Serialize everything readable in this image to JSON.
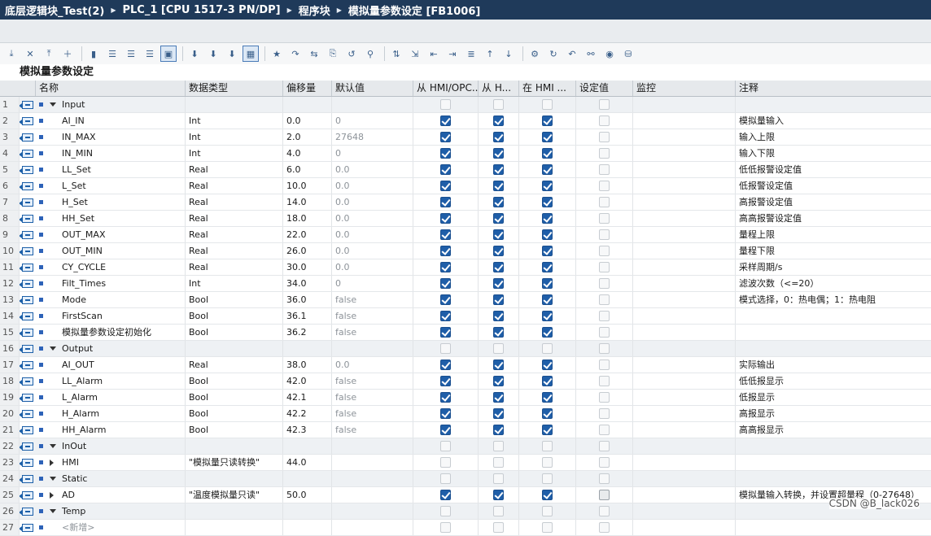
{
  "titlebar": {
    "crumbs": [
      "底层逻辑块_Test(2)",
      "PLC_1 [CPU 1517-3 PN/DP]",
      "程序块",
      "模拟量参数设定 [FB1006]"
    ]
  },
  "block_title": "模拟量参数设定",
  "columns": [
    "名称",
    "数据类型",
    "偏移量",
    "默认值",
    "从 HMI/OPC...",
    "从 H...",
    "在 HMI ...",
    "设定值",
    "监控",
    "注释"
  ],
  "rows": [
    {
      "num": "1",
      "kind": "section",
      "name": "Input",
      "type": "",
      "offset": "",
      "default": "",
      "c1": false,
      "c2": false,
      "c3": false,
      "set": false,
      "comment": ""
    },
    {
      "num": "2",
      "kind": "item",
      "name": "AI_IN",
      "type": "Int",
      "offset": "0.0",
      "default": "0",
      "c1": true,
      "c2": true,
      "c3": true,
      "set": false,
      "comment": "模拟量输入"
    },
    {
      "num": "3",
      "kind": "item",
      "name": "IN_MAX",
      "type": "Int",
      "offset": "2.0",
      "default": "27648",
      "c1": true,
      "c2": true,
      "c3": true,
      "set": false,
      "comment": "输入上限"
    },
    {
      "num": "4",
      "kind": "item",
      "name": "IN_MIN",
      "type": "Int",
      "offset": "4.0",
      "default": "0",
      "c1": true,
      "c2": true,
      "c3": true,
      "set": false,
      "comment": "输入下限"
    },
    {
      "num": "5",
      "kind": "item",
      "name": "LL_Set",
      "type": "Real",
      "offset": "6.0",
      "default": "0.0",
      "c1": true,
      "c2": true,
      "c3": true,
      "set": false,
      "comment": "低低报警设定值"
    },
    {
      "num": "6",
      "kind": "item",
      "name": "L_Set",
      "type": "Real",
      "offset": "10.0",
      "default": "0.0",
      "c1": true,
      "c2": true,
      "c3": true,
      "set": false,
      "comment": "低报警设定值"
    },
    {
      "num": "7",
      "kind": "item",
      "name": "H_Set",
      "type": "Real",
      "offset": "14.0",
      "default": "0.0",
      "c1": true,
      "c2": true,
      "c3": true,
      "set": false,
      "comment": "高报警设定值"
    },
    {
      "num": "8",
      "kind": "item",
      "name": "HH_Set",
      "type": "Real",
      "offset": "18.0",
      "default": "0.0",
      "c1": true,
      "c2": true,
      "c3": true,
      "set": false,
      "comment": "高高报警设定值"
    },
    {
      "num": "9",
      "kind": "item",
      "name": "OUT_MAX",
      "type": "Real",
      "offset": "22.0",
      "default": "0.0",
      "c1": true,
      "c2": true,
      "c3": true,
      "set": false,
      "comment": "量程上限"
    },
    {
      "num": "10",
      "kind": "item",
      "name": "OUT_MIN",
      "type": "Real",
      "offset": "26.0",
      "default": "0.0",
      "c1": true,
      "c2": true,
      "c3": true,
      "set": false,
      "comment": "量程下限"
    },
    {
      "num": "11",
      "kind": "item",
      "name": "CY_CYCLE",
      "type": "Real",
      "offset": "30.0",
      "default": "0.0",
      "c1": true,
      "c2": true,
      "c3": true,
      "set": false,
      "comment": "采样周期/s"
    },
    {
      "num": "12",
      "kind": "item",
      "name": "Filt_Times",
      "type": "Int",
      "offset": "34.0",
      "default": "0",
      "c1": true,
      "c2": true,
      "c3": true,
      "set": false,
      "comment": "滤波次数（<=20）"
    },
    {
      "num": "13",
      "kind": "item",
      "name": "Mode",
      "type": "Bool",
      "offset": "36.0",
      "default": "false",
      "c1": true,
      "c2": true,
      "c3": true,
      "set": false,
      "comment": "模式选择，0：热电偶；1：热电阻"
    },
    {
      "num": "14",
      "kind": "item",
      "name": "FirstScan",
      "type": "Bool",
      "offset": "36.1",
      "default": "false",
      "c1": true,
      "c2": true,
      "c3": true,
      "set": false,
      "comment": ""
    },
    {
      "num": "15",
      "kind": "item",
      "name": "模拟量参数设定初始化",
      "type": "Bool",
      "offset": "36.2",
      "default": "false",
      "c1": true,
      "c2": true,
      "c3": true,
      "set": false,
      "comment": ""
    },
    {
      "num": "16",
      "kind": "section",
      "name": "Output",
      "type": "",
      "offset": "",
      "default": "",
      "c1": false,
      "c2": false,
      "c3": false,
      "set": false,
      "comment": ""
    },
    {
      "num": "17",
      "kind": "item",
      "name": "AI_OUT",
      "type": "Real",
      "offset": "38.0",
      "default": "0.0",
      "c1": true,
      "c2": true,
      "c3": true,
      "set": false,
      "comment": "实际输出"
    },
    {
      "num": "18",
      "kind": "item",
      "name": "LL_Alarm",
      "type": "Bool",
      "offset": "42.0",
      "default": "false",
      "c1": true,
      "c2": true,
      "c3": true,
      "set": false,
      "comment": "低低报显示"
    },
    {
      "num": "19",
      "kind": "item",
      "name": "L_Alarm",
      "type": "Bool",
      "offset": "42.1",
      "default": "false",
      "c1": true,
      "c2": true,
      "c3": true,
      "set": false,
      "comment": "低报显示"
    },
    {
      "num": "20",
      "kind": "item",
      "name": "H_Alarm",
      "type": "Bool",
      "offset": "42.2",
      "default": "false",
      "c1": true,
      "c2": true,
      "c3": true,
      "set": false,
      "comment": "高报显示"
    },
    {
      "num": "21",
      "kind": "item",
      "name": "HH_Alarm",
      "type": "Bool",
      "offset": "42.3",
      "default": "false",
      "c1": true,
      "c2": true,
      "c3": true,
      "set": false,
      "comment": "高高报显示"
    },
    {
      "num": "22",
      "kind": "section",
      "name": "InOut",
      "type": "",
      "offset": "",
      "default": "",
      "c1": false,
      "c2": false,
      "c3": false,
      "set": false,
      "comment": ""
    },
    {
      "num": "23",
      "kind": "struct",
      "name": "HMI",
      "type": "\"模拟量只读转换\"",
      "offset": "44.0",
      "default": "",
      "c1": false,
      "c2": false,
      "c3": false,
      "set": false,
      "comment": ""
    },
    {
      "num": "24",
      "kind": "section",
      "name": "Static",
      "type": "",
      "offset": "",
      "default": "",
      "c1": false,
      "c2": false,
      "c3": false,
      "set": false,
      "comment": ""
    },
    {
      "num": "25",
      "kind": "struct",
      "name": "AD",
      "type": "\"温度模拟量只读\"",
      "offset": "50.0",
      "default": "",
      "c1": true,
      "c2": true,
      "c3": true,
      "set": "grey",
      "comment": "模拟量输入转换，并设置超量程（0-27648）"
    },
    {
      "num": "26",
      "kind": "section",
      "name": "Temp",
      "type": "",
      "offset": "",
      "default": "",
      "c1": false,
      "c2": false,
      "c3": false,
      "set": false,
      "comment": ""
    },
    {
      "num": "27",
      "kind": "add",
      "name": "<新增>",
      "type": "",
      "offset": "",
      "default": "",
      "c1": false,
      "c2": false,
      "c3": false,
      "set": false,
      "comment": ""
    }
  ],
  "watermark": "CSDN @B_lack026",
  "toolbar_icons": [
    "insert-row-icon",
    "delete-row-icon",
    "insert-row-below-icon",
    "add-row-icon",
    "monitor-icon",
    "interface-view-1-icon",
    "interface-view-2-icon",
    "interface-view-3-icon",
    "comment-view-icon",
    "download-icon",
    "download-2-icon",
    "download-3-icon",
    "network-view-icon",
    "favorites-icon",
    "goto-icon",
    "compare-icon",
    "snapshot-icon",
    "reset-icon",
    "filter-icon",
    "sort-icon",
    "export-icon",
    "indent-left-icon",
    "indent-right-icon",
    "align-icon",
    "move-up-icon",
    "move-down-icon",
    "settings-icon",
    "refresh-icon",
    "undo-icon",
    "search-icon",
    "monitor-all-icon",
    "database-icon"
  ]
}
